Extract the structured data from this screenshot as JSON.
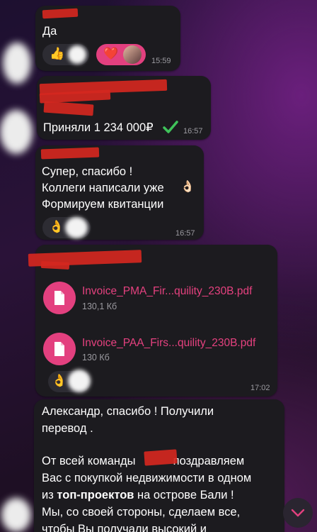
{
  "messages": {
    "m1": {
      "text": "Да",
      "time": "15:59",
      "reactions": [
        "👍",
        "❤️"
      ]
    },
    "m2": {
      "text": "Приняли 1 234 000₽",
      "time": "16:57"
    },
    "m3": {
      "lines": [
        "Супер, спасибо !",
        "Коллеги написали уже",
        "Формируем квитанции"
      ],
      "time": "16:57",
      "reaction": "👌"
    },
    "m4": {
      "files": [
        {
          "name": "Invoice_PMA_Fir...quility_230B.pdf",
          "size": "130,1 Кб"
        },
        {
          "name": "Invoice_PAA_Firs...quility_230B.pdf",
          "size": "130 Кб"
        }
      ],
      "time": "17:02",
      "reaction": "👌"
    },
    "m5": {
      "line1": "Александр, спасибо ! Получили",
      "line2": "перевод .",
      "line3a": "От всей команды",
      "line3b": "поздравляем",
      "line4": "Вас с покупкой недвижимости в одном",
      "line5a": "из",
      "line5b": "топ-проектов",
      "line5c": "на острове Бали !",
      "line6": "Мы, со своей стороны, сделаем все,",
      "line7": "чтобы Вы получали высокий и"
    }
  },
  "colors": {
    "accent": "#e3407f",
    "bubble": "#1c1b1f",
    "check": "#3fc35a"
  },
  "icons": {
    "check": "checkmark-icon",
    "file": "document-icon",
    "scroll": "chevron-down-icon"
  }
}
